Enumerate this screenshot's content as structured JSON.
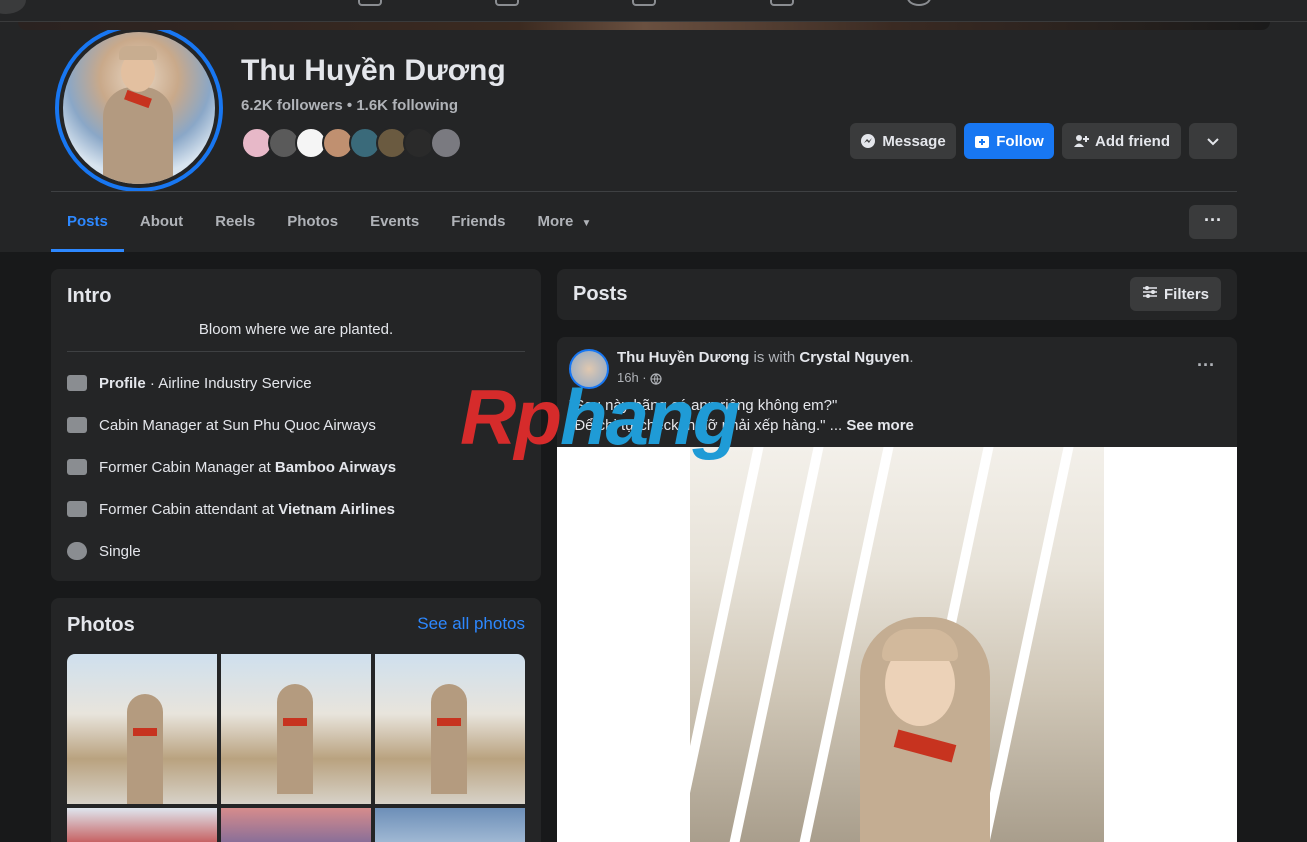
{
  "profile": {
    "name": "Thu Huyền Dương",
    "followers": "6.2K followers",
    "separator": "•",
    "following": "1.6K following"
  },
  "actions": {
    "message": "Message",
    "follow": "Follow",
    "add_friend": "Add friend"
  },
  "tabs": [
    "Posts",
    "About",
    "Reels",
    "Photos",
    "Events",
    "Friends",
    "More"
  ],
  "intro": {
    "title": "Intro",
    "bio": "Bloom where we are planted.",
    "items": [
      {
        "prefix": "",
        "bold": "Profile",
        "suffix": " · Airline Industry Service"
      },
      {
        "prefix": "Cabin Manager at Sun Phu Quoc Airways",
        "bold": "",
        "suffix": ""
      },
      {
        "prefix": "Former Cabin Manager at ",
        "bold": "Bamboo Airways",
        "suffix": ""
      },
      {
        "prefix": "Former Cabin attendant at ",
        "bold": "Vietnam Airlines",
        "suffix": ""
      },
      {
        "prefix": "Single",
        "bold": "",
        "suffix": ""
      }
    ]
  },
  "photos": {
    "title": "Photos",
    "see_all": "See all photos"
  },
  "posts": {
    "title": "Posts",
    "filters": "Filters",
    "post": {
      "author": "Thu Huyền Dương",
      "with_text": " is with ",
      "tagged": "Crystal Nguyen",
      "time": "16h ·",
      "line1": "\"Sau này hãng có app riêng không em?\"",
      "line2": "\"Để chị tự check-in đỡ phải xếp hàng.\" ...",
      "see_more": "See more"
    }
  },
  "watermark": {
    "part1": "Rp",
    "part2": "hang"
  },
  "colors": {
    "accent": "#1877f2",
    "bg": "#18191a",
    "card": "#242526"
  }
}
